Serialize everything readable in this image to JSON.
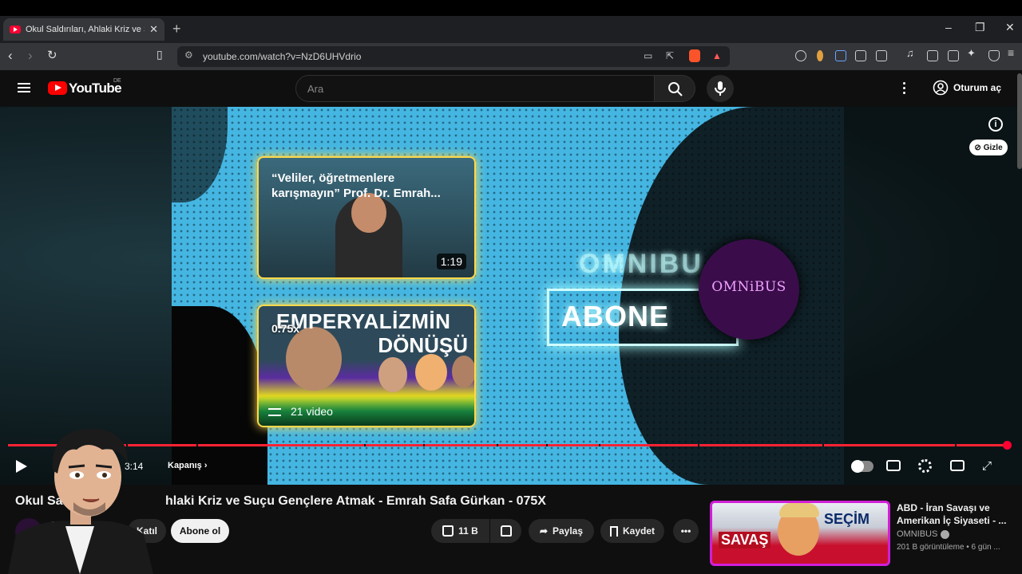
{
  "browser": {
    "tab_title": "Okul Saldırıları, Ahlaki Kriz ve Su",
    "url": "youtube.com/watch?v=NzD6UHVdrio"
  },
  "youtube": {
    "logo_text": "YouTube",
    "country_code": "DE",
    "search_placeholder": "Ara",
    "signin_label": "Oturum aç"
  },
  "player": {
    "card1_title": "“Veliler, öğretmenlere karışmayın” Prof. Dr. Emrah...",
    "card1_duration": "1:19",
    "card2_line1": "EMPERYALİZMİN",
    "card2_line2": "DÖNÜŞÜ",
    "card2_speed": "0.75x",
    "card2_count": "21 video",
    "ghost_logo": "OMNIBU",
    "subscribe_banner": "ABONE",
    "channel_logo": "OMNiBUS",
    "hide_label": "Gizle",
    "time": "3:14",
    "chapter": "Kapanış",
    "progress_fraction": 1.0
  },
  "video": {
    "title": "Okul Saldırıları, Ahlaki Kriz ve Suçu Gençlere Atmak - Emrah Safa Gürkan - 075X",
    "title_visible": "Okul Sal",
    "title_rest": "hlaki Kriz ve Suçu Gençlere Atmak - Emrah Safa Gürkan - 075X",
    "channel": "OMNIBUS",
    "join_label": "Katıl",
    "subscribe_label": "Abone ol",
    "likes": "11 B",
    "share_label": "Paylaş",
    "save_label": "Kaydet"
  },
  "recommended": [
    {
      "thumb_text_left": "SAVAŞ",
      "thumb_text_right": "SEÇİM",
      "title": "ABD - İran Savaşı ve Amerikan İç Siyaseti - ...",
      "channel": "OMNIBUS",
      "meta": "201 B görüntüleme • 6 gün ..."
    }
  ],
  "colors": {
    "accent": "#ff0033",
    "frame_bg": "#45b6e2",
    "card_glow": "#ffd84a",
    "rec_border": "#d01fd8"
  }
}
